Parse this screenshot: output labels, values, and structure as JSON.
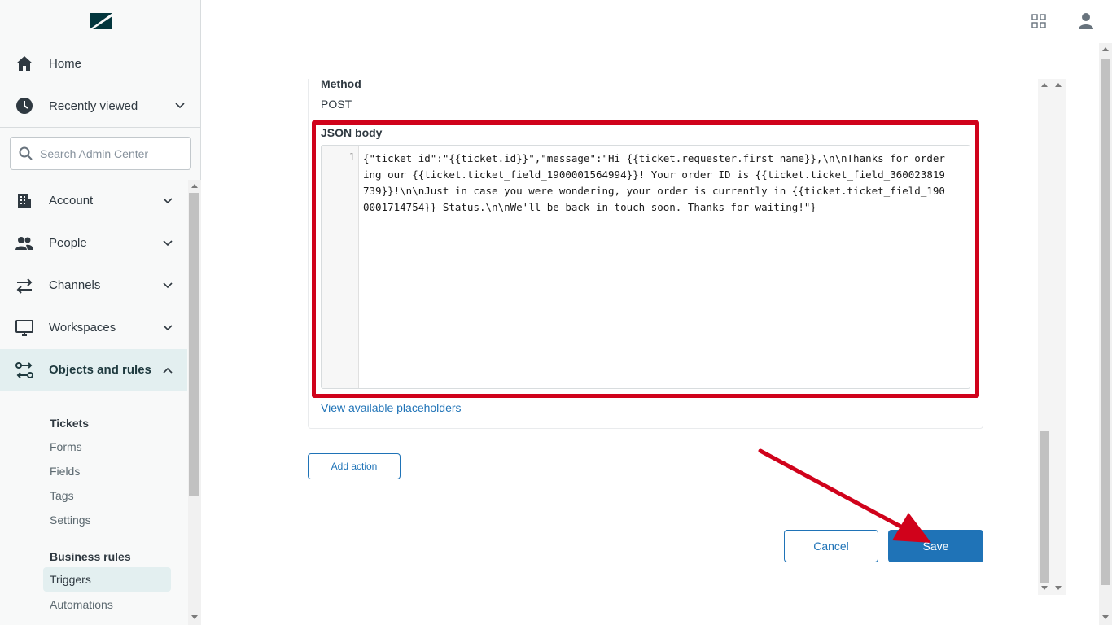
{
  "sidebar": {
    "home_label": "Home",
    "recent_label": "Recently viewed",
    "search_placeholder": "Search Admin Center",
    "nav": [
      {
        "label": "Account"
      },
      {
        "label": "People"
      },
      {
        "label": "Channels"
      },
      {
        "label": "Workspaces"
      },
      {
        "label": "Objects and rules"
      }
    ],
    "tickets_heading": "Tickets",
    "tickets_items": [
      "Forms",
      "Fields",
      "Tags",
      "Settings"
    ],
    "business_heading": "Business rules",
    "business_items": [
      "Triggers",
      "Automations"
    ],
    "active_color": "#e3eff0"
  },
  "header": {
    "apps_icon": "grid-icon",
    "user_icon": "user-icon"
  },
  "form": {
    "method_label": "Method",
    "method_value": "POST",
    "json_label": "JSON body",
    "line_number": "1",
    "json_body": "{\"ticket_id\":\"{{ticket.id}}\",\"message\":\"Hi {{ticket.requester.first_name}},\\n\\nThanks for ordering our {{ticket.ticket_field_1900001564994}}! Your order ID is {{ticket.ticket_field_360023819739}}!\\n\\nJust in case you were wondering, your order is currently in {{ticket.ticket_field_1900001714754}} Status.\\n\\nWe'll be back in touch soon. Thanks for waiting!\"}",
    "placeholders_link": "View available placeholders",
    "add_action_label": "Add action",
    "cancel_label": "Cancel",
    "save_label": "Save"
  },
  "colors": {
    "accent": "#1f73b7",
    "highlight": "#d0021b"
  }
}
